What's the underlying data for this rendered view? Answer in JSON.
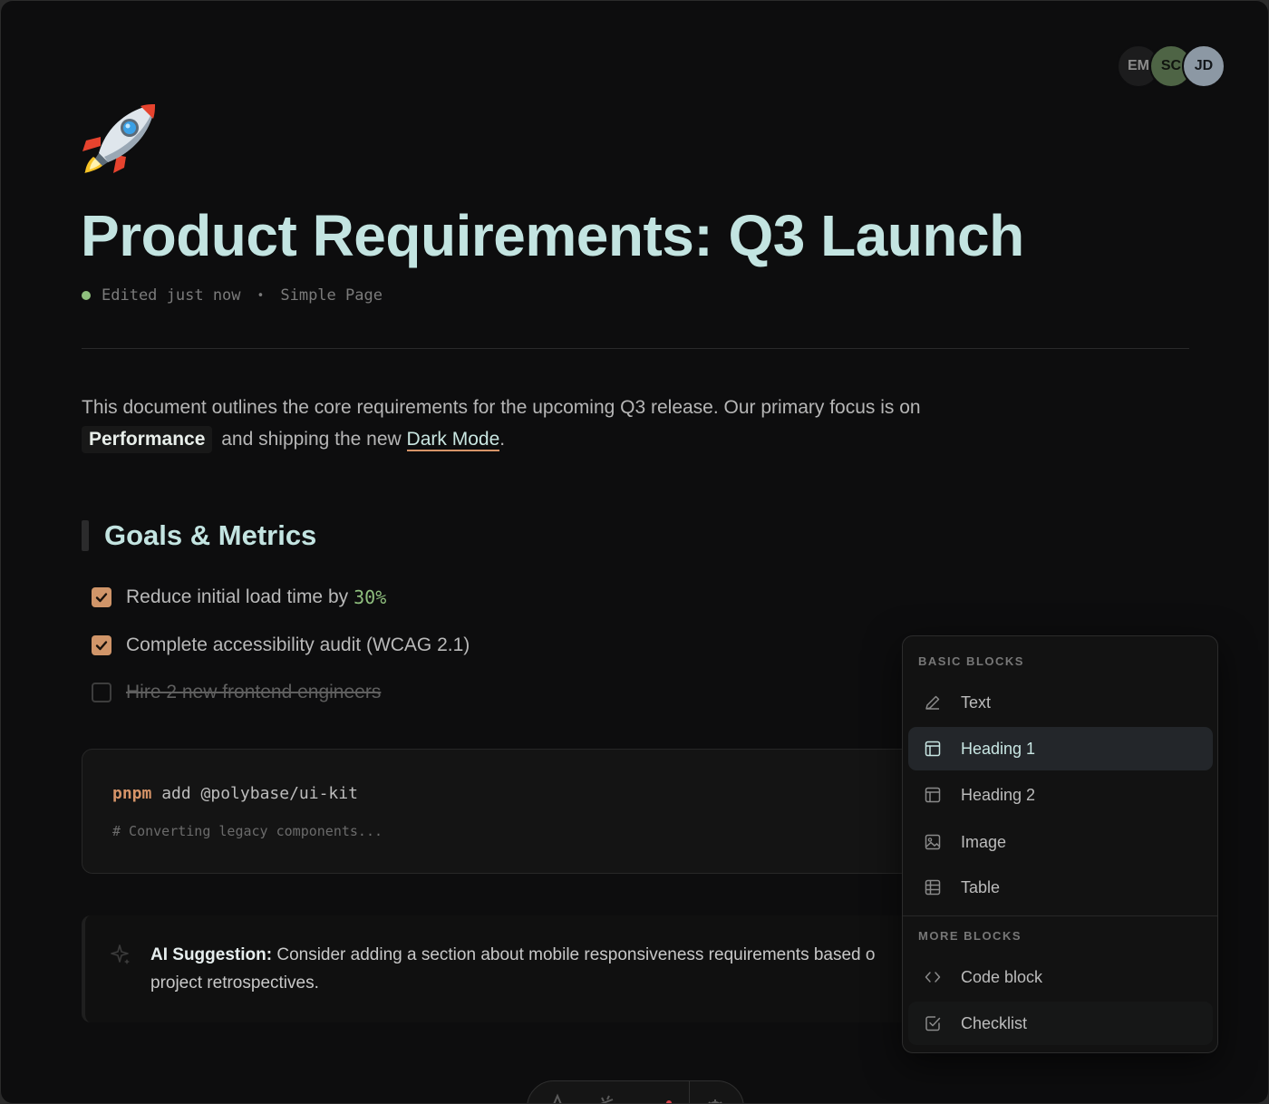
{
  "collaborators": [
    {
      "initials": "EM"
    },
    {
      "initials": "SC"
    },
    {
      "initials": "JD"
    }
  ],
  "page": {
    "emoji": "rocket",
    "title": "Product Requirements: Q3 Launch",
    "status": "Edited just now",
    "separator": "•",
    "page_type": "Simple Page"
  },
  "intro": {
    "text_before": "This document outlines the core requirements for the upcoming Q3 release. Our primary focus is on ",
    "highlight": "Performance",
    "text_middle": " and shipping the new ",
    "link": "Dark Mode",
    "text_after": "."
  },
  "section": {
    "heading": "Goals & Metrics"
  },
  "todos": [
    {
      "text": "Reduce initial load time by",
      "metric": "30%",
      "checked": true
    },
    {
      "text": "Complete accessibility audit (WCAG 2.1)",
      "checked": true
    },
    {
      "text": "Hire 2 new frontend engineers",
      "checked": false
    }
  ],
  "code": {
    "command": "pnpm",
    "args": " add @polybase/ui-kit",
    "comment": "# Converting legacy components..."
  },
  "callout": {
    "label": "AI Suggestion:",
    "text": " Consider adding a section about mobile responsiveness requirements based o",
    "text_line2": "project retrospectives."
  },
  "block_menu": {
    "basic_title": "BASIC BLOCKS",
    "basic_items": [
      {
        "label": "Text",
        "icon": "pencil-icon"
      },
      {
        "label": "Heading 1",
        "icon": "layout-icon",
        "active": true
      },
      {
        "label": "Heading 2",
        "icon": "layout-icon"
      },
      {
        "label": "Image",
        "icon": "image-icon"
      },
      {
        "label": "Table",
        "icon": "table-icon"
      }
    ],
    "more_title": "MORE BLOCKS",
    "more_items": [
      {
        "label": "Code block",
        "icon": "code-icon"
      },
      {
        "label": "Checklist",
        "icon": "checkbox-icon",
        "hover": true
      }
    ]
  },
  "colors": {
    "accent_title": "#c3e4e1",
    "checkbox": "#d09569",
    "metric": "#8fbf7e",
    "link_underline": "#d69468"
  }
}
